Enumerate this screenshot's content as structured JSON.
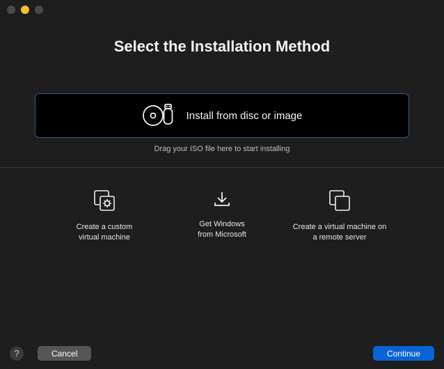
{
  "titlebar": {
    "close_name": "close",
    "minimize_name": "minimize",
    "maximize_name": "maximize"
  },
  "header": {
    "title": "Select the Installation Method"
  },
  "drop": {
    "label": "Install from disc or image",
    "hint": "Drag your ISO file here to start installing"
  },
  "options": {
    "custom": "Create a custom\nvirtual machine",
    "windows": "Get Windows\nfrom Microsoft",
    "remote": "Create a virtual machine on\na remote server"
  },
  "footer": {
    "help": "?",
    "cancel": "Cancel",
    "continue": "Continue"
  }
}
